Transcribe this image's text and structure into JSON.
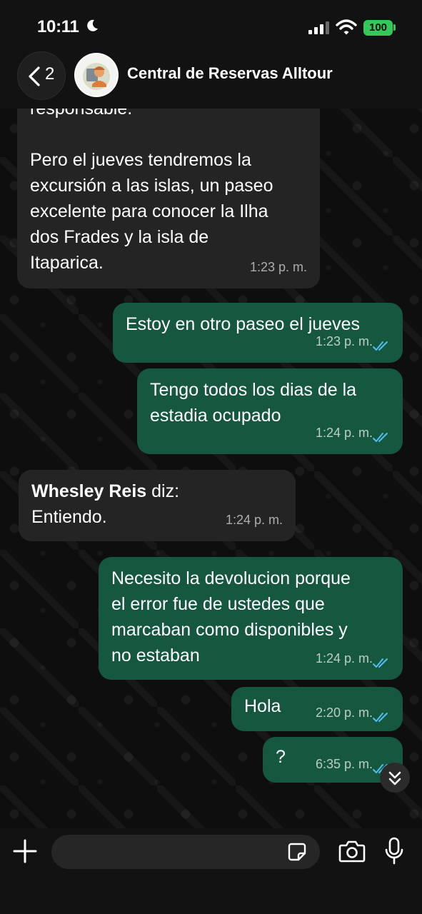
{
  "status_bar": {
    "time": "10:11",
    "battery": "100"
  },
  "header": {
    "back_count": "2",
    "contact_name": "Central de Reservas Alltour"
  },
  "messages": [
    {
      "direction": "in",
      "text": "responsable.\n\nPero el jueves tendremos la\nexcursión a las islas, un paseo\nexcelente para conocer la Ilha\ndos Frades y la isla de\nItaparica.",
      "time": "1:23 p. m."
    },
    {
      "direction": "out",
      "text": "Estoy en otro paseo el jueves",
      "time": "1:23 p. m."
    },
    {
      "direction": "out",
      "text": "Tengo todos los dias de la\nestadia ocupado",
      "time": "1:24 p. m."
    },
    {
      "direction": "in",
      "sender": "Whesley Reis",
      "sender_suffix": " diz:",
      "text": "Entiendo.",
      "time": "1:24 p. m."
    },
    {
      "direction": "out",
      "text": "Necesito la devolucion porque\nel error fue de ustedes que\nmarcaban como disponibles y\nno estaban",
      "time": "1:24 p. m."
    },
    {
      "direction": "out",
      "text": "Hola",
      "time": "2:20 p. m."
    },
    {
      "direction": "out",
      "text": "?",
      "time": "6:35 p. m."
    }
  ],
  "input": {
    "placeholder": ""
  },
  "colors": {
    "outgoing_bubble": "#15573f",
    "incoming_bubble": "#242424",
    "read_ticks": "#53bdeb",
    "battery": "#34c759"
  },
  "icons": [
    "moon-icon",
    "signal-icon",
    "wifi-icon",
    "chevron-left-icon",
    "double-check-icon",
    "chevrons-down-icon",
    "plus-icon",
    "sticker-icon",
    "camera-icon",
    "microphone-icon"
  ]
}
